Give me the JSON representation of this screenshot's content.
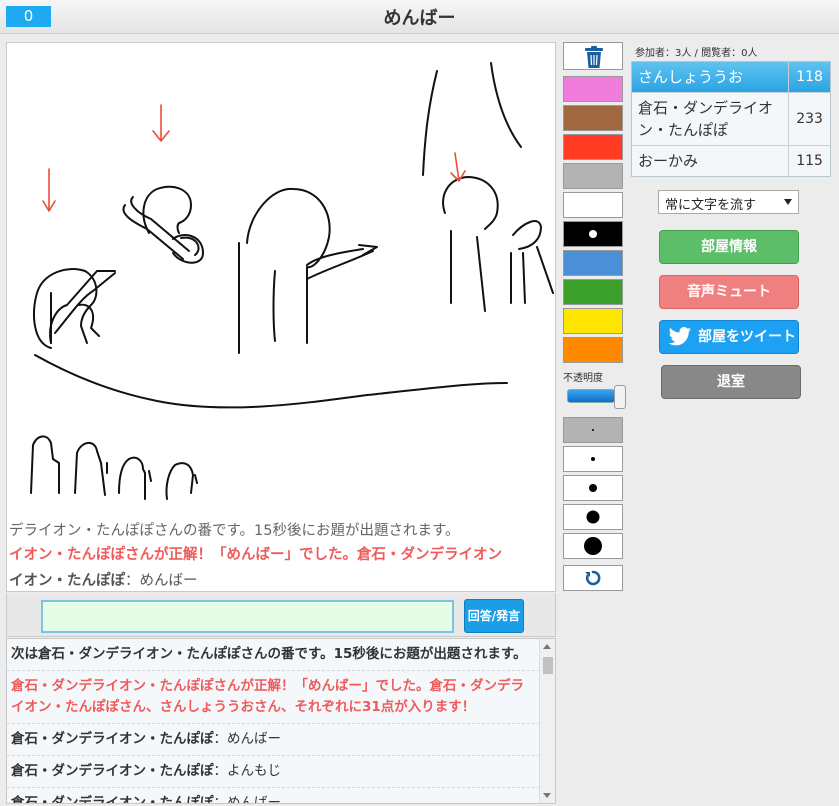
{
  "header": {
    "timer": "0",
    "title": "めんばー"
  },
  "canvas": {
    "overlay_lines": [
      "デライオン・たんぽぽさんの番です。15秒後にお題が出題されます。",
      "イオン・たんぽぽさんが正解！「めんばー」でした。倉石・ダンデライオン",
      {
        "name": "イオン・たんぽぽ",
        "text": "：めんばー"
      }
    ]
  },
  "input": {
    "value": "",
    "send_label": "回答/発言"
  },
  "log": [
    {
      "type": "sys",
      "text": "次は倉石・ダンデライオン・たんぽぽさんの番です。15秒後にお題が出題されます。"
    },
    {
      "type": "correct",
      "text": "倉石・ダンデライオン・たんぽぽさんが正解！「めんばー」でした。倉石・ダンデライオン・たんぽぽさん、さんしょううおさん、それぞれに31点が入ります！"
    },
    {
      "type": "chat",
      "name": "倉石・ダンデライオン・たんぽぽ",
      "text": "：めんばー"
    },
    {
      "type": "chat",
      "name": "倉石・ダンデライオン・たんぽぽ",
      "text": "：よんもじ"
    },
    {
      "type": "chat",
      "name": "倉石・ダンデライオン・たんぽぽ",
      "text": "：めんばー"
    }
  ],
  "palette": {
    "colors": [
      "#f07ddb",
      "#a0683e",
      "#ff3b24",
      "#b3b3b3",
      "#ffffff",
      "#000000",
      "#4b8fd6",
      "#3ca12a",
      "#ffe600",
      "#ff8a00"
    ],
    "selected_index": 5,
    "opacity_label": "不透明度",
    "opacity_value": 100,
    "brush_sizes": [
      2,
      4,
      8,
      13,
      18
    ],
    "selected_brush": 0,
    "icons": {
      "clear": "trash-icon",
      "undo": "undo-icon"
    }
  },
  "room": {
    "counts": "参加者：3人 / 閲覧者：0人",
    "players": [
      {
        "name": "さんしょううお",
        "score": "118"
      },
      {
        "name": "倉石・ダンデライオン・たんぽぽ",
        "score": "233"
      },
      {
        "name": "おーかみ",
        "score": "115"
      }
    ],
    "mode_select": "常に文字を流す",
    "buttons": {
      "info": "部屋情報",
      "mute": "音声ミュート",
      "tweet": "部屋をツイート",
      "exit": "退室"
    }
  },
  "colors": {
    "accent": "#1eaaf1",
    "correct_text": "#f05a5a",
    "info_button": "#5dbe6a",
    "mute_button": "#f08080",
    "tweet_button": "#1da1f2",
    "exit_button": "#888888"
  }
}
